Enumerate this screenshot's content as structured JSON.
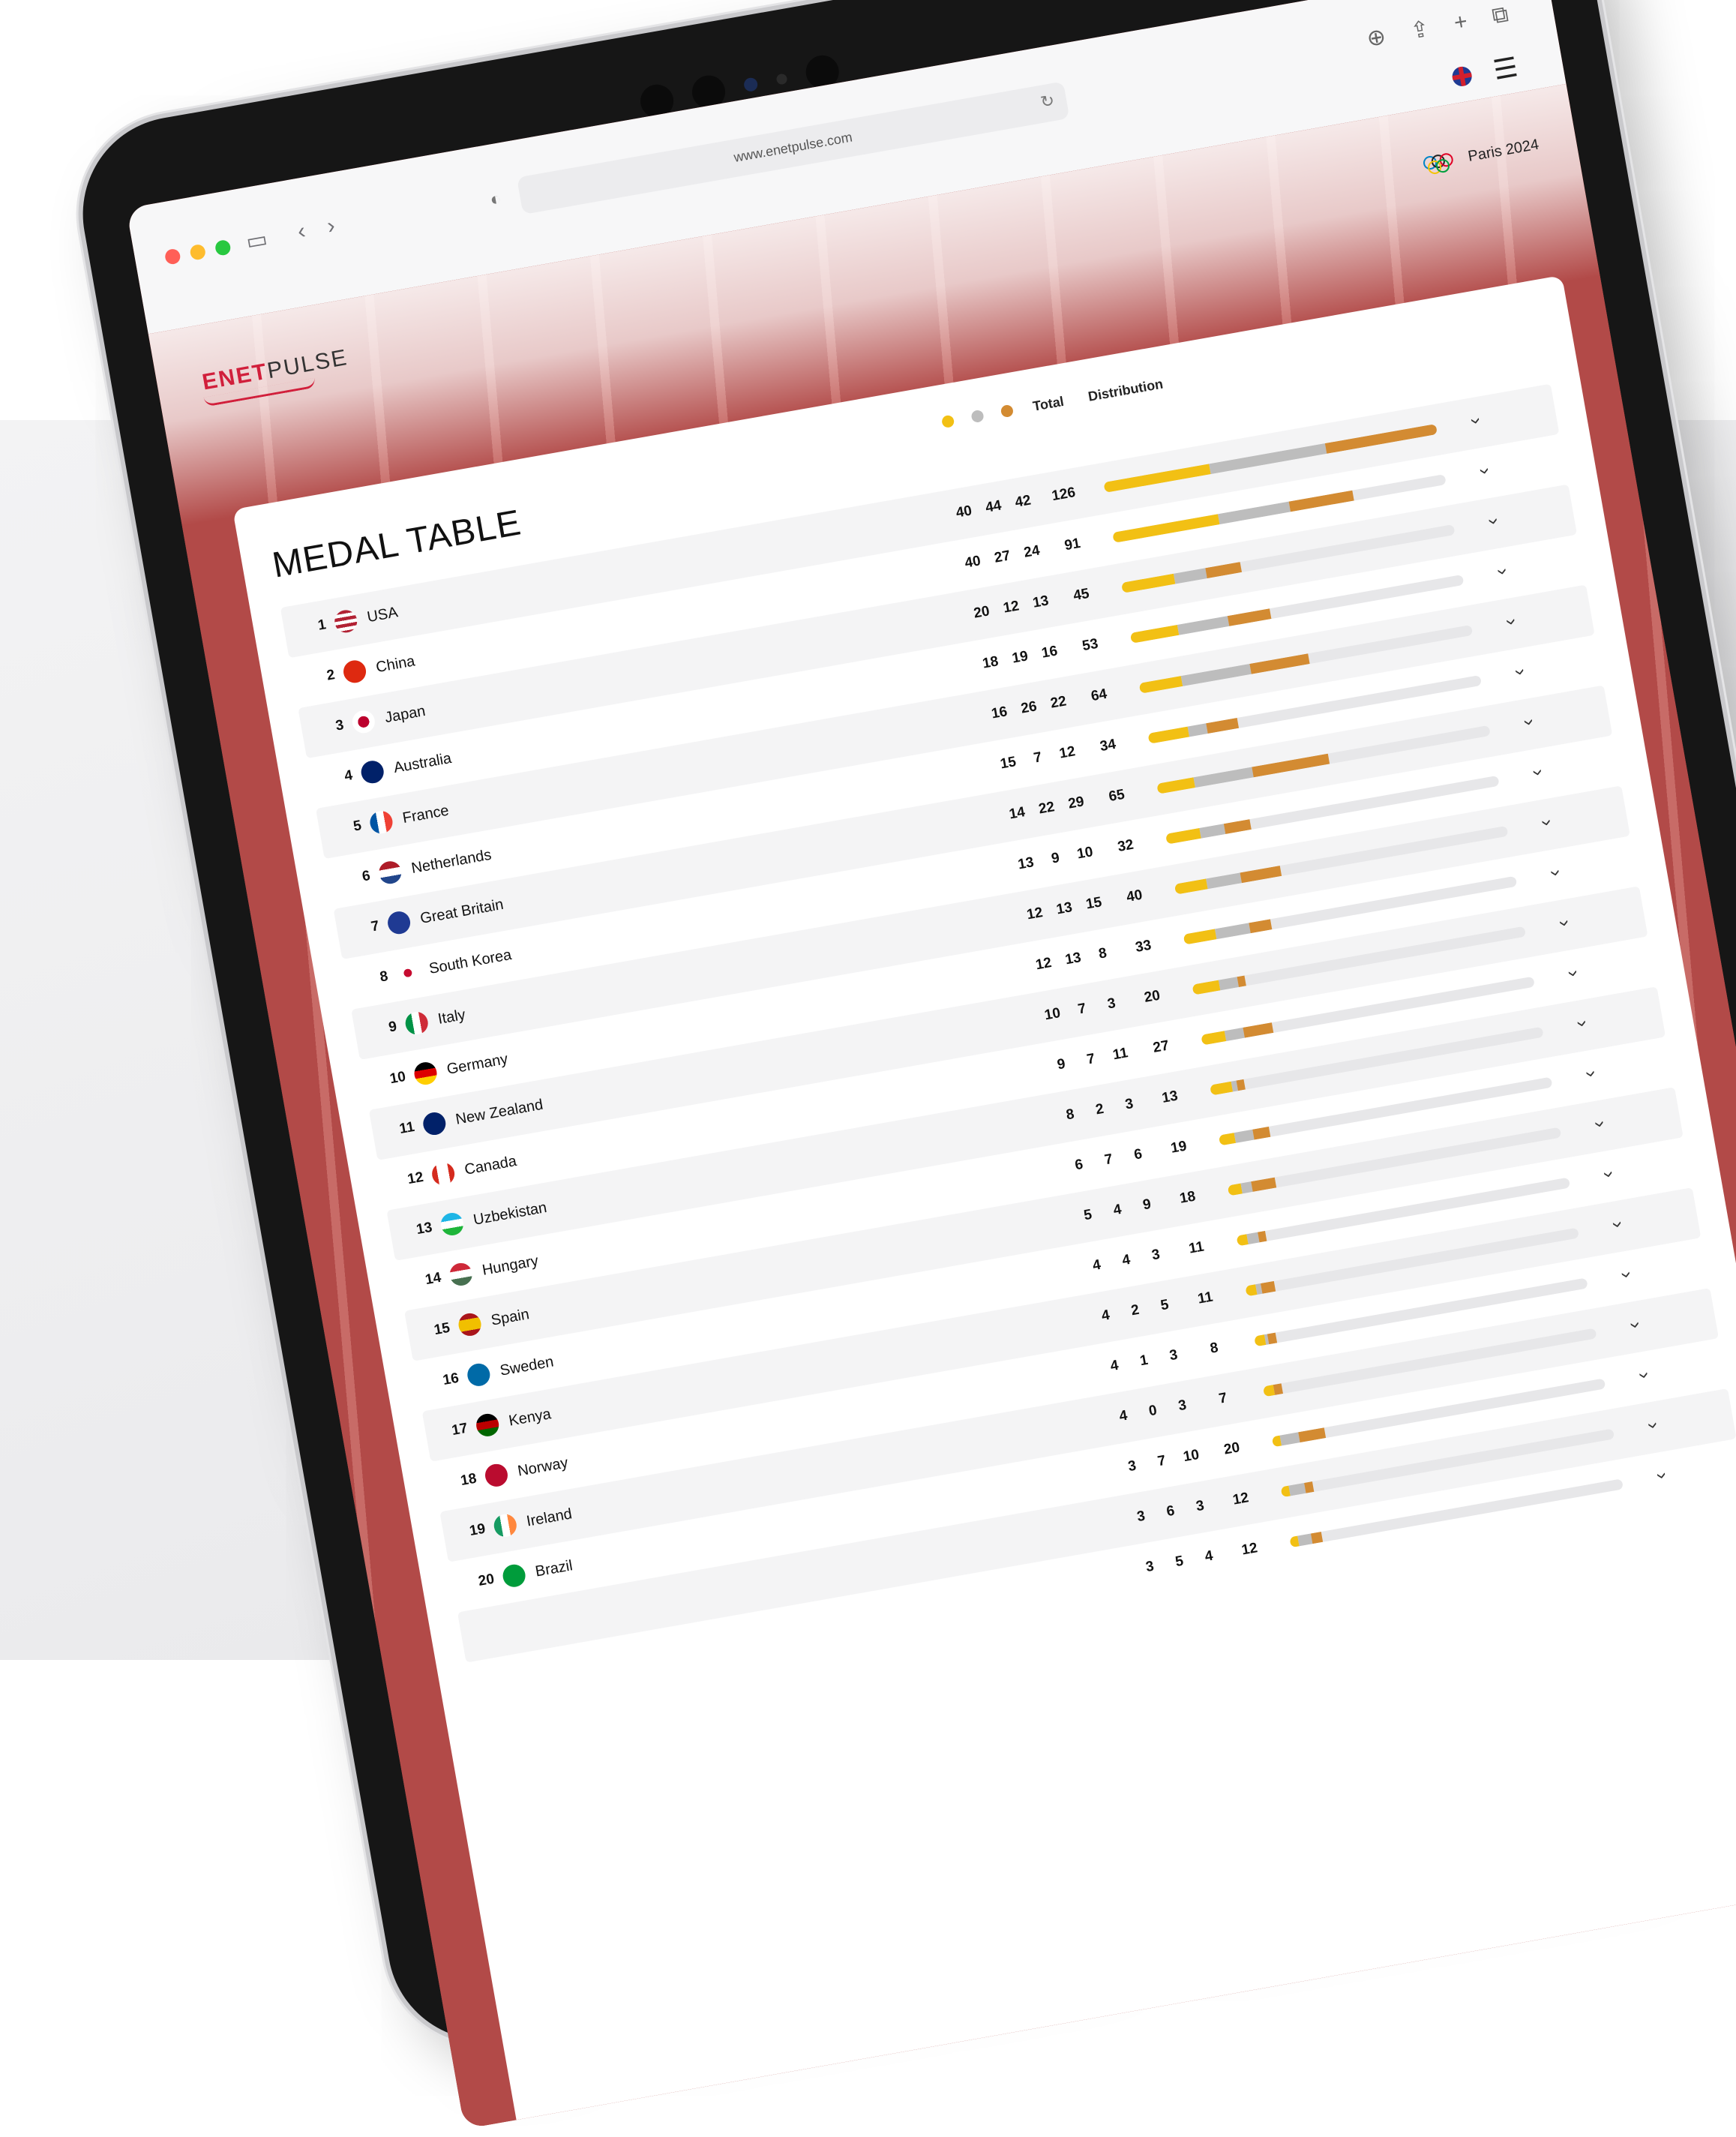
{
  "browser": {
    "url": "www.enetpulse.com",
    "traffic_colors": [
      "#ff5f57",
      "#febc2e",
      "#28c840"
    ]
  },
  "site": {
    "logo_part1": "ENET",
    "logo_part2": "PULSE",
    "event": "Paris 2024"
  },
  "table": {
    "title": "MEDAL TABLE",
    "col_total": "Total",
    "col_distribution": "Distribution",
    "colors": {
      "gold": "#f2c014",
      "silver": "#bdbdbd",
      "bronze": "#d38b32"
    },
    "max_total": 126,
    "rows": [
      {
        "rank": "1",
        "country": "USA",
        "gold": 40,
        "silver": 44,
        "bronze": 42,
        "total": 126
      },
      {
        "rank": "2",
        "country": "China",
        "gold": 40,
        "silver": 27,
        "bronze": 24,
        "total": 91
      },
      {
        "rank": "3",
        "country": "Japan",
        "gold": 20,
        "silver": 12,
        "bronze": 13,
        "total": 45
      },
      {
        "rank": "4",
        "country": "Australia",
        "gold": 18,
        "silver": 19,
        "bronze": 16,
        "total": 53
      },
      {
        "rank": "5",
        "country": "France",
        "gold": 16,
        "silver": 26,
        "bronze": 22,
        "total": 64
      },
      {
        "rank": "6",
        "country": "Netherlands",
        "gold": 15,
        "silver": 7,
        "bronze": 12,
        "total": 34
      },
      {
        "rank": "7",
        "country": "Great Britain",
        "gold": 14,
        "silver": 22,
        "bronze": 29,
        "total": 65
      },
      {
        "rank": "8",
        "country": "South Korea",
        "gold": 13,
        "silver": 9,
        "bronze": 10,
        "total": 32
      },
      {
        "rank": "9",
        "country": "Italy",
        "gold": 12,
        "silver": 13,
        "bronze": 15,
        "total": 40
      },
      {
        "rank": "10",
        "country": "Germany",
        "gold": 12,
        "silver": 13,
        "bronze": 8,
        "total": 33
      },
      {
        "rank": "11",
        "country": "New Zealand",
        "gold": 10,
        "silver": 7,
        "bronze": 3,
        "total": 20
      },
      {
        "rank": "12",
        "country": "Canada",
        "gold": 9,
        "silver": 7,
        "bronze": 11,
        "total": 27
      },
      {
        "rank": "13",
        "country": "Uzbekistan",
        "gold": 8,
        "silver": 2,
        "bronze": 3,
        "total": 13
      },
      {
        "rank": "14",
        "country": "Hungary",
        "gold": 6,
        "silver": 7,
        "bronze": 6,
        "total": 19
      },
      {
        "rank": "15",
        "country": "Spain",
        "gold": 5,
        "silver": 4,
        "bronze": 9,
        "total": 18
      },
      {
        "rank": "16",
        "country": "Sweden",
        "gold": 4,
        "silver": 4,
        "bronze": 3,
        "total": 11
      },
      {
        "rank": "17",
        "country": "Kenya",
        "gold": 4,
        "silver": 2,
        "bronze": 5,
        "total": 11
      },
      {
        "rank": "18",
        "country": "Norway",
        "gold": 4,
        "silver": 1,
        "bronze": 3,
        "total": 8
      },
      {
        "rank": "19",
        "country": "Ireland",
        "gold": 4,
        "silver": 0,
        "bronze": 3,
        "total": 7
      },
      {
        "rank": "20",
        "country": "Brazil",
        "gold": 3,
        "silver": 7,
        "bronze": 10,
        "total": 20
      }
    ],
    "extra_rows": [
      {
        "gold": 3,
        "silver": 6,
        "bronze": 3,
        "total": 12
      },
      {
        "gold": 3,
        "silver": 5,
        "bronze": 4,
        "total": 12
      }
    ]
  }
}
